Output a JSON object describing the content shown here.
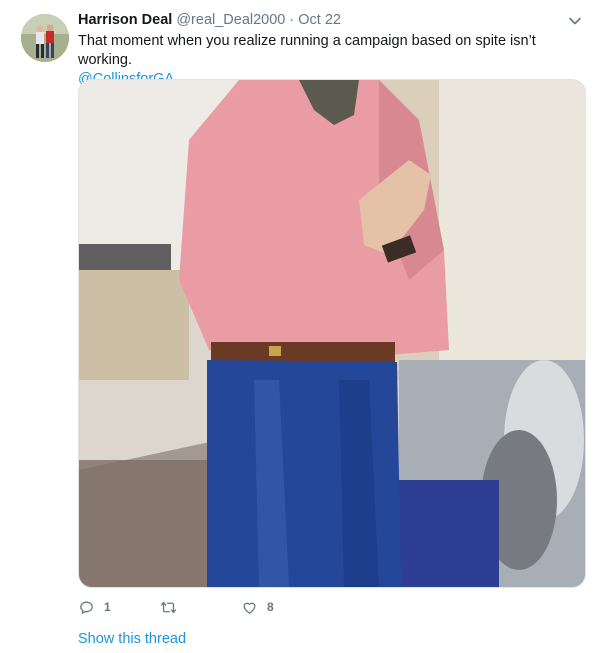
{
  "tweet": {
    "author_name": "Harrison Deal",
    "author_handle": "@real_Deal2000",
    "separator": "·",
    "date": "Oct 22",
    "text": "That moment when you realize running a campaign based on spite isn’t working.",
    "mention": "@CollinsforGA",
    "replies": "1",
    "retweets": "",
    "likes": "8",
    "show_thread": "Show this thread"
  },
  "icons": {
    "menu": "chevron-down-icon",
    "reply": "reply-icon",
    "retweet": "retweet-icon",
    "like": "heart-icon"
  },
  "colors": {
    "link": "#1b95e0",
    "muted": "#657786",
    "text": "#14171a",
    "border": "#dde3e8"
  }
}
